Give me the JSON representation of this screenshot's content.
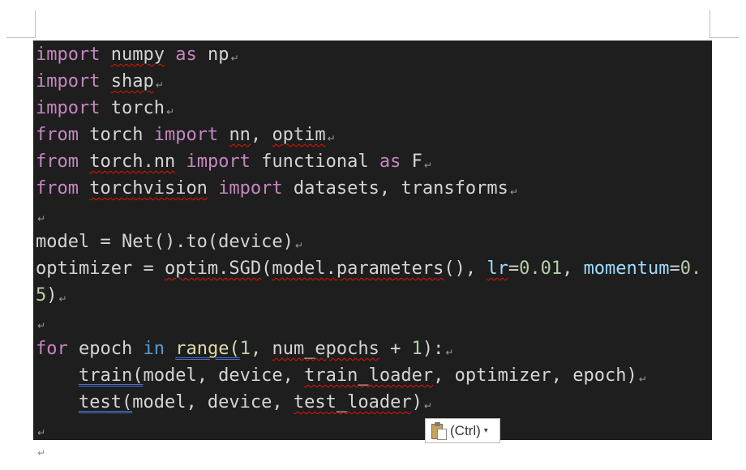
{
  "code": {
    "lines": {
      "l1": {
        "a": "import",
        "b": " ",
        "c": "numpy",
        "d": " ",
        "e": "as",
        "f": " np"
      },
      "l2": {
        "a": "import",
        "b": " ",
        "c": "shap"
      },
      "l3": {
        "a": "import",
        "b": " torch"
      },
      "l4": {
        "a": "from",
        "b": " torch ",
        "c": "import",
        "d": " ",
        "e": "nn",
        ",": ",",
        "f": " ",
        "g": "optim"
      },
      "l5": {
        "a": "from",
        "b": " ",
        "c": "torch.nn",
        "d": " ",
        "e": "import",
        "f": " functional ",
        "g": "as",
        "h": " F"
      },
      "l6": {
        "a": "from",
        "b": " ",
        "c": "torchvision",
        "d": " ",
        "e": "import",
        "f": " datasets, transforms"
      },
      "l8": {
        "a": "model = Net().to(device)"
      },
      "l9": {
        "a": "optimizer = ",
        "b": "optim.SGD",
        "c": "(",
        "d": "model.parameters",
        "e": "(), ",
        "f": "lr",
        "g": "=",
        "h": "0.01",
        ",": ", ",
        "i": "momentum",
        "j": "=",
        "k": "0."
      },
      "l10": {
        "a": "5",
        "b": ")"
      },
      "l12": {
        "a": "for",
        "b": " epoch ",
        "c": "in",
        "d": " ",
        "e": "range(",
        "f": "1",
        ",": ", ",
        "g": "num_epochs",
        "h": " + ",
        "i": "1",
        "j": "):"
      },
      "l13": {
        "a": "    ",
        "b": "train(",
        "c": "model, device, ",
        "d": "train_loader",
        "e": ", optimizer, epoch)"
      },
      "l14": {
        "a": "    ",
        "b": "test(",
        "c": "model, device, ",
        "d": "test_loader",
        "e": ")"
      }
    },
    "paragraph_mark": "↵"
  },
  "paste_options": {
    "label": "(Ctrl)",
    "caret": "▾"
  },
  "colors": {
    "code_background": "#1e1e1e",
    "keyword_import": "#c586c0",
    "keyword_control": "#569cd6",
    "number": "#b5cea8",
    "parameter": "#9cdcfe",
    "function": "#dcdcaa",
    "spellcheck": "#e51400"
  }
}
